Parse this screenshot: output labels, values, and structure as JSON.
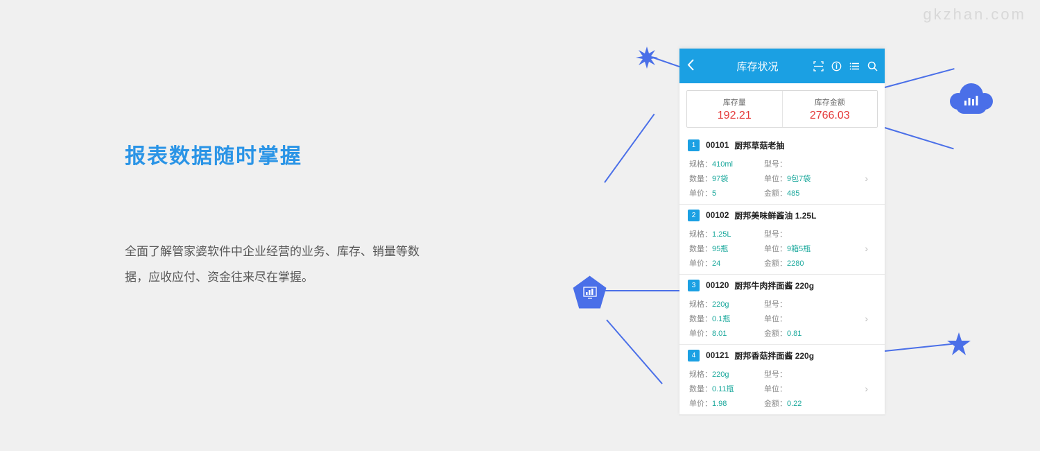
{
  "watermark": "gkzhan.com",
  "headline": "报表数据随时掌握",
  "description": "全面了解管家婆软件中企业经营的业务、库存、销量等数据，应收应付、资金往来尽在掌握。",
  "app": {
    "title": "库存状况",
    "summary": {
      "qty_label": "库存量",
      "qty_value": "192.21",
      "amt_label": "库存金额",
      "amt_value": "2766.03"
    },
    "labels": {
      "spec": "规格：",
      "model": "型号：",
      "qty": "数量：",
      "unit": "单位：",
      "price": "单价：",
      "amount": "金额："
    },
    "items": [
      {
        "idx": "1",
        "code": "00101",
        "name": "厨邦草菇老抽",
        "spec": "410ml",
        "model": "",
        "qty": "97袋",
        "unit": "9包7袋",
        "price": "5",
        "amount": "485"
      },
      {
        "idx": "2",
        "code": "00102",
        "name": "厨邦美味鲜酱油 1.25L",
        "spec": "1.25L",
        "model": "",
        "qty": "95瓶",
        "unit": "9箱5瓶",
        "price": "24",
        "amount": "2280"
      },
      {
        "idx": "3",
        "code": "00120",
        "name": "厨邦牛肉拌面酱 220g",
        "spec": "220g",
        "model": "",
        "qty": "0.1瓶",
        "unit": "",
        "price": "8.01",
        "amount": "0.81"
      },
      {
        "idx": "4",
        "code": "00121",
        "name": "厨邦香菇拌面酱 220g",
        "spec": "220g",
        "model": "",
        "qty": "0.11瓶",
        "unit": "",
        "price": "1.98",
        "amount": "0.22"
      }
    ]
  }
}
